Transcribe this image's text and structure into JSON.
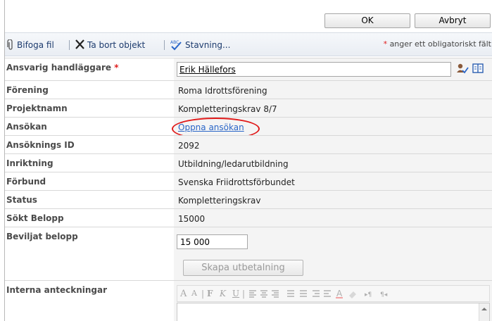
{
  "buttons": {
    "ok": "OK",
    "cancel": "Avbryt"
  },
  "toolbar": {
    "attach": "Bifoga fil",
    "delete": "Ta bort objekt",
    "spelling": "Stavning...",
    "required_note": "anger ett obligatoriskt fält",
    "required_mark": "*"
  },
  "fields": {
    "handler": {
      "label": "Ansvarig handläggare",
      "required": "*",
      "value": "Erik Hällefors"
    },
    "association": {
      "label": "Förening",
      "value": "Roma Idrottsförening"
    },
    "project": {
      "label": "Projektnamn",
      "value": "Kompletteringskrav 8/7"
    },
    "application": {
      "label": "Ansökan",
      "link": "Öppna ansökan"
    },
    "application_id": {
      "label": "Ansöknings ID",
      "value": "2092"
    },
    "direction": {
      "label": "Inriktning",
      "value": "Utbildning/ledarutbildning"
    },
    "federation": {
      "label": "Förbund",
      "value": "Svenska Friidrottsförbundet"
    },
    "status": {
      "label": "Status",
      "value": "Kompletteringskrav"
    },
    "requested": {
      "label": "Sökt Belopp",
      "value": "15000"
    },
    "granted": {
      "label": "Beviljat belopp",
      "value": "15 000",
      "create_payment": "Skapa utbetalning"
    },
    "notes": {
      "label": "Interna anteckningar"
    }
  },
  "rte": {
    "font_size_up": "A",
    "font_size_down": "A",
    "bold": "F",
    "italic": "K",
    "underline": "U"
  },
  "colors": {
    "highlight": "#e01a1a",
    "link": "#2a66c8",
    "required": "#e02020"
  }
}
